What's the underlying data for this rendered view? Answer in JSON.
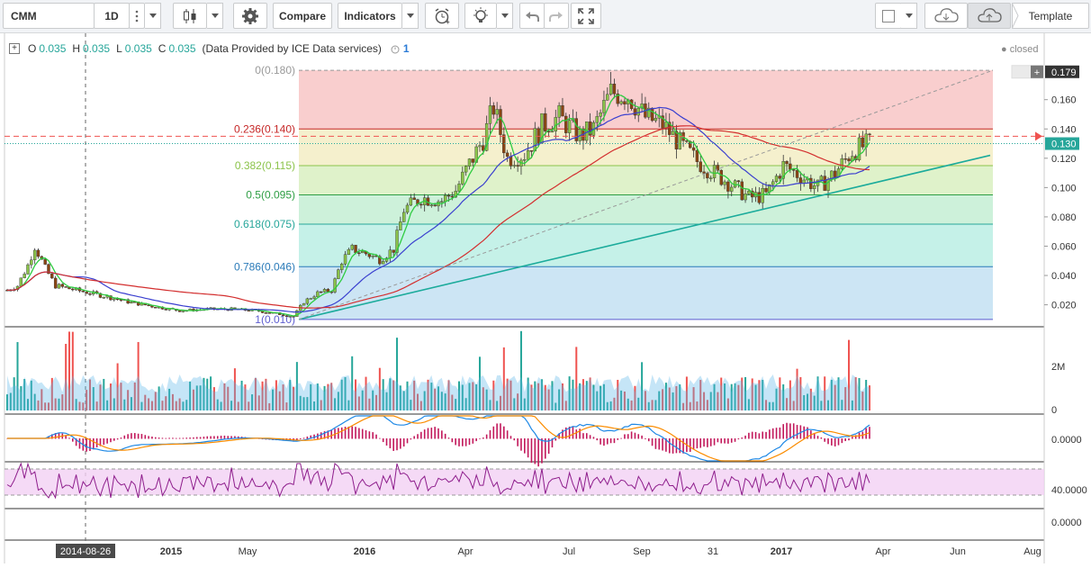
{
  "toolbar": {
    "symbol": "CMM",
    "interval": "1D",
    "compare_label": "Compare",
    "indicators_label": "Indicators",
    "template_label": "Template"
  },
  "legend": {
    "o_label": "O",
    "o_value": "0.035",
    "h_label": "H",
    "h_value": "0.035",
    "l_label": "L",
    "l_value": "0.035",
    "c_label": "C",
    "c_value": "0.035",
    "source": "(Data Provided by ICE Data services)",
    "alerts_count": "1"
  },
  "status": {
    "closed_label": "closed"
  },
  "colors": {
    "bull": "#26a69a",
    "bear": "#ef5350",
    "candle_up": "#8bc34a",
    "candle_down": "#8b4513",
    "ma_fast": "#2ecc40",
    "ma_mid": "#3a3fcf",
    "ma_slow": "#d32f2f",
    "trend": "#1bab9b",
    "rsi_band": "#f3d1f4",
    "rsi_line": "#8e1d8c"
  },
  "chart_data": [
    {
      "type": "candlestick",
      "title": "",
      "y_axis_ticks": [
        "0.160",
        "0.140",
        "0.120",
        "0.100",
        "0.080",
        "0.060",
        "0.040",
        "0.020"
      ],
      "ylim": [
        0.005,
        0.185
      ],
      "last_price_label": "0.179",
      "current_price_label": "0.130",
      "fib_levels": [
        {
          "label": "0(0.180)",
          "value": 0.18,
          "fill": "#f8c9c9",
          "line": "#999999"
        },
        {
          "label": "0.236(0.140)",
          "value": 0.14,
          "fill": "#f4eec8",
          "line": "#c62828"
        },
        {
          "label": "0.382(0.115)",
          "value": 0.115,
          "fill": "#dbf1c4",
          "line": "#8bc34a"
        },
        {
          "label": "0.5(0.095)",
          "value": 0.095,
          "fill": "#c8f0d6",
          "line": "#2e9e44"
        },
        {
          "label": "0.618(0.075)",
          "value": 0.075,
          "fill": "#bff0e6",
          "line": "#26a69a"
        },
        {
          "label": "0.786(0.046)",
          "value": 0.046,
          "fill": "#c6e2f3",
          "line": "#2b7bb9"
        },
        {
          "label": "1(0.010)",
          "value": 0.01,
          "fill": "#e0e0e0",
          "line": "#5c5ccf"
        }
      ],
      "x_axis_labels": [
        "2015",
        "May",
        "2016",
        "Apr",
        "Jul",
        "Sep",
        "31",
        "2017",
        "Apr",
        "Jun",
        "Aug"
      ],
      "crosshair_date": "2014-08-26",
      "series": [
        {
          "name": "",
          "points": [
            [
              0,
              0.03
            ],
            [
              3,
              0.033
            ],
            [
              6,
              0.047
            ],
            [
              8,
              0.06
            ],
            [
              11,
              0.045
            ],
            [
              14,
              0.033
            ],
            [
              20,
              0.03
            ],
            [
              28,
              0.026
            ],
            [
              35,
              0.022
            ],
            [
              42,
              0.019
            ],
            [
              50,
              0.016
            ],
            [
              58,
              0.017
            ],
            [
              65,
              0.017
            ],
            [
              72,
              0.016
            ],
            [
              78,
              0.014
            ],
            [
              83,
              0.012
            ],
            [
              86,
              0.022
            ],
            [
              90,
              0.028
            ],
            [
              94,
              0.03
            ],
            [
              97,
              0.05
            ],
            [
              100,
              0.058
            ],
            [
              104,
              0.055
            ],
            [
              108,
              0.051
            ],
            [
              112,
              0.058
            ],
            [
              115,
              0.085
            ],
            [
              120,
              0.093
            ],
            [
              126,
              0.091
            ],
            [
              130,
              0.098
            ],
            [
              134,
              0.116
            ],
            [
              138,
              0.133
            ],
            [
              141,
              0.155
            ],
            [
              145,
              0.12
            ],
            [
              150,
              0.123
            ],
            [
              155,
              0.142
            ],
            [
              160,
              0.148
            ],
            [
              166,
              0.135
            ],
            [
              170,
              0.14
            ],
            [
              175,
              0.165
            ],
            [
              180,
              0.163
            ],
            [
              185,
              0.148
            ],
            [
              190,
              0.143
            ],
            [
              195,
              0.13
            ],
            [
              200,
              0.118
            ],
            [
              205,
              0.11
            ],
            [
              210,
              0.102
            ],
            [
              215,
              0.093
            ],
            [
              220,
              0.095
            ],
            [
              225,
              0.115
            ],
            [
              230,
              0.108
            ],
            [
              235,
              0.1
            ],
            [
              240,
              0.11
            ],
            [
              245,
              0.125
            ],
            [
              250,
              0.13
            ]
          ]
        }
      ]
    },
    {
      "type": "bar",
      "title": "",
      "y_axis_ticks": [
        "2M",
        "0"
      ]
    },
    {
      "type": "line",
      "title": "",
      "y_axis_ticks": [
        "0.0000"
      ]
    },
    {
      "type": "line",
      "title": "",
      "y_axis_ticks": [
        "40.0000"
      ]
    },
    {
      "type": "line",
      "title": "",
      "y_axis_ticks": [
        "0.0000"
      ]
    }
  ]
}
